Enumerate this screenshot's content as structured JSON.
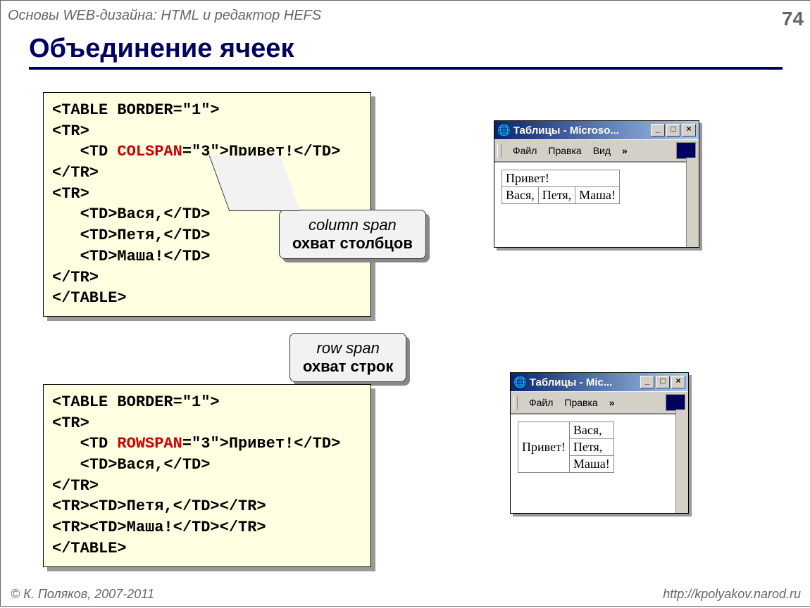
{
  "header": {
    "course": "Основы WEB-дизайна: HTML и редактор HEFS",
    "page": "74"
  },
  "title": "Объединение ячеек",
  "code1": {
    "l1": "<TABLE BORDER=\"1\">",
    "l2": "<TR>",
    "l3a": "   <TD ",
    "l3b": "COLSPAN",
    "l3c": "=\"3\">Привет!</TD>",
    "l4": "</TR>",
    "l5": "<TR>",
    "l6": "   <TD>Вася,</TD>",
    "l7": "   <TD>Петя,</TD>",
    "l8": "   <TD>Маша!</TD>",
    "l9": "</TR>",
    "l10": "</TABLE>"
  },
  "callout1": {
    "line1": "column span",
    "line2": "охват столбцов"
  },
  "callout2": {
    "line1": "row span",
    "line2": "охват строк"
  },
  "code2": {
    "l1": "<TABLE BORDER=\"1\">",
    "l2": "<TR>",
    "l3a": "   <TD ",
    "l3b": "ROWSPAN",
    "l3c": "=\"3\">Привет!</TD>",
    "l4": "   <TD>Вася,</TD>",
    "l5": "</TR>",
    "l6": "<TR><TD>Петя,</TD></TR>",
    "l7": "<TR><TD>Маша!</TD></TR>",
    "l8": "</TABLE>"
  },
  "win1": {
    "title": "Таблицы - Microso...",
    "menu": {
      "m1": "Файл",
      "m2": "Правка",
      "m3": "Вид",
      "chev": "»"
    },
    "table": {
      "r1c1": "Привет!",
      "r2c1": "Вася,",
      "r2c2": "Петя,",
      "r2c3": "Маша!"
    }
  },
  "win2": {
    "title": "Таблицы - Mic...",
    "menu": {
      "m1": "Файл",
      "m2": "Правка",
      "chev": "»"
    },
    "table": {
      "c1": "Привет!",
      "r1": "Вася,",
      "r2": "Петя,",
      "r3": "Маша!"
    }
  },
  "footer": {
    "left": "© К. Поляков, 2007-2011",
    "right": "http://kpolyakov.narod.ru"
  }
}
